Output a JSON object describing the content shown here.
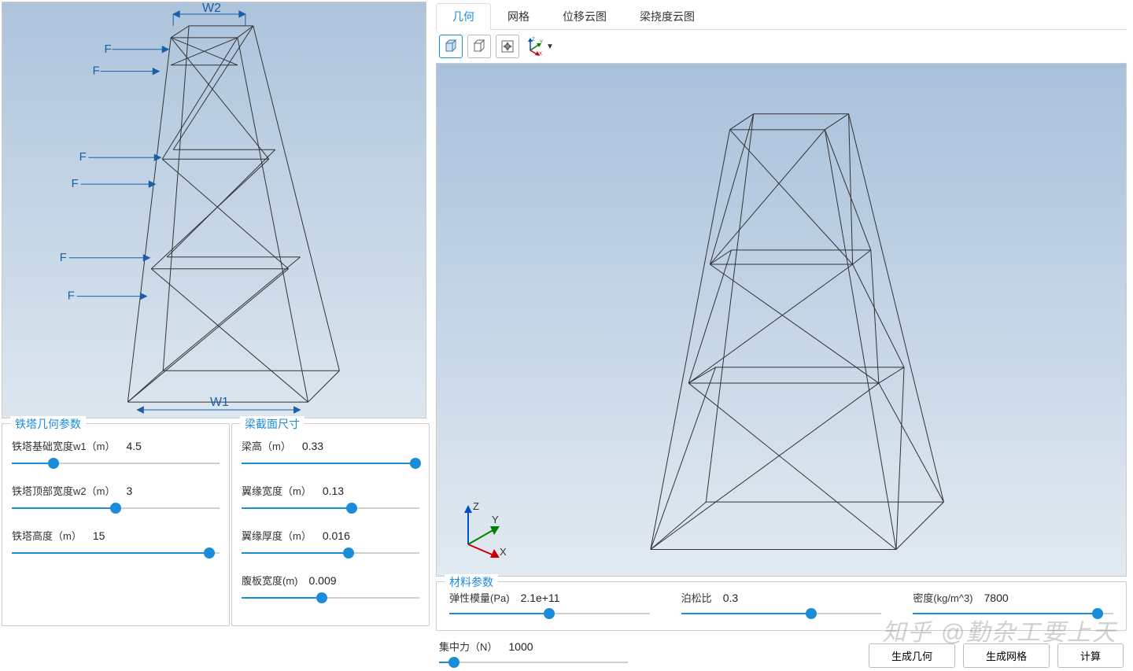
{
  "diagram_labels": {
    "w2": "W2",
    "w1": "W1",
    "force": "F"
  },
  "tower_params": {
    "title": "铁塔几何参数",
    "w1": {
      "label": "铁塔基础宽度w1（m）",
      "value": "4.5",
      "pct": 20
    },
    "w2": {
      "label": "铁塔顶部宽度w2（m）",
      "value": "3",
      "pct": 50
    },
    "h": {
      "label": "铁塔高度（m）",
      "value": "15",
      "pct": 95
    }
  },
  "beam_params": {
    "title": "梁截面尺寸",
    "height": {
      "label": "梁高（m）",
      "value": "0.33",
      "pct": 98
    },
    "flange_w": {
      "label": "翼缘宽度（m）",
      "value": "0.13",
      "pct": 62
    },
    "flange_t": {
      "label": "翼缘厚度（m）",
      "value": "0.016",
      "pct": 60
    },
    "web_w": {
      "label": "腹板宽度(m)",
      "value": "0.009",
      "pct": 45
    }
  },
  "tabs": [
    {
      "label": "几何",
      "active": true
    },
    {
      "label": "网格",
      "active": false
    },
    {
      "label": "位移云图",
      "active": false
    },
    {
      "label": "梁挠度云图",
      "active": false
    }
  ],
  "toolbar": {
    "cube_solid": "solid-view",
    "cube_wire": "wireframe-view",
    "fit": "fit-view",
    "axis": "axis-orientation"
  },
  "axis_labels": {
    "x": "X",
    "y": "Y",
    "z": "Z"
  },
  "material": {
    "title": "材料参数",
    "modulus": {
      "label": "弹性模量(Pa)",
      "value": "2.1e+11",
      "pct": 50
    },
    "poisson": {
      "label": "泊松比",
      "value": "0.3",
      "pct": 65
    },
    "density": {
      "label": "密度(kg/m^3)",
      "value": "7800",
      "pct": 92
    }
  },
  "force": {
    "label": "集中力（N）",
    "value": "1000",
    "pct": 8
  },
  "buttons": {
    "gen_geom": "生成几何",
    "gen_mesh": "生成网格",
    "compute": "计算"
  },
  "watermark": "知乎 @勤杂工要上天"
}
